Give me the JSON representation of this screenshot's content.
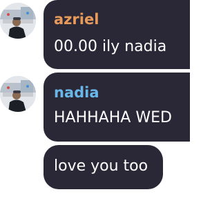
{
  "messages": [
    {
      "author": "azriel",
      "author_color": "#e89a5a",
      "text": "00.00 ily nadia"
    },
    {
      "author": "nadia",
      "author_color": "#69b7e8",
      "text": "HAHHAHA WED"
    },
    {
      "author": "",
      "text": "love you too"
    }
  ],
  "colors": {
    "bubble": "#2a2836",
    "text": "#ffffff"
  }
}
